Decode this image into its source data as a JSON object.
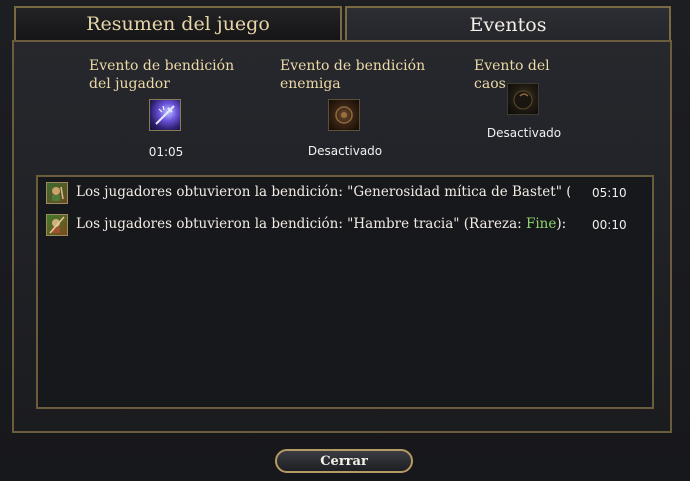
{
  "tabs": {
    "summary_label": "Resumen del juego",
    "events_label": "Eventos"
  },
  "blessings": {
    "player": {
      "title": "Evento de bendición del jugador",
      "status": "01:05",
      "icon": "player-blessing-icon"
    },
    "enemy": {
      "title": "Evento de bendición enemiga",
      "status": "Desactivado",
      "icon": "enemy-blessing-icon"
    },
    "chaos": {
      "title": "Evento del caos",
      "status": "Desactivado",
      "icon": "chaos-event-icon"
    }
  },
  "log": [
    {
      "prefix": "Los jugadores obtuvieron la bendición: \"Generosidad mítica de Bastet\" (Rareza",
      "rarity": "",
      "suffix": "",
      "time": "05:10"
    },
    {
      "prefix": "Los jugadores obtuvieron la bendición: \"Hambre tracia\" (Rareza: ",
      "rarity": "Fine",
      "suffix": "): Cavalr",
      "time": "00:10"
    }
  ],
  "buttons": {
    "close_label": "Cerrar"
  },
  "colors": {
    "gold_border": "#7a6a44",
    "rarity_fine": "#8fd46a",
    "title_gold": "#ecd9a6"
  }
}
